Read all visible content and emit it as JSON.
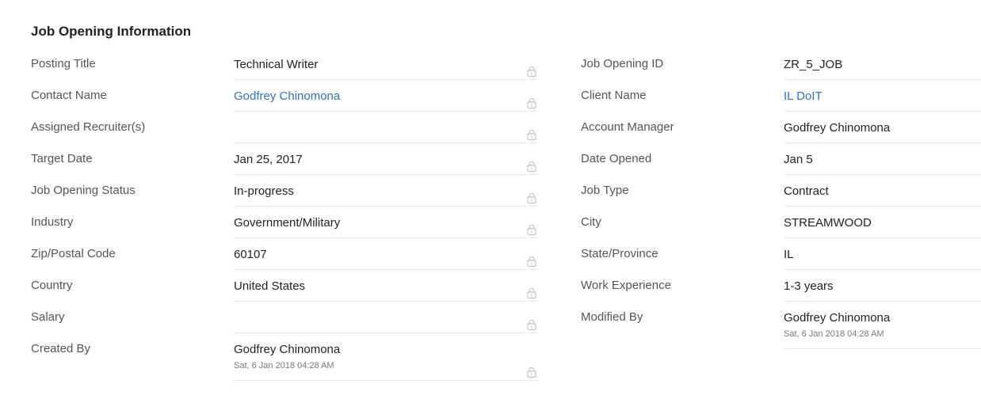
{
  "section": {
    "title": "Job Opening Information"
  },
  "left_fields": [
    {
      "label": "Posting Title",
      "value": "Technical Writer",
      "link": false,
      "sub": ""
    },
    {
      "label": "Contact Name",
      "value": "Godfrey Chinomona",
      "link": true,
      "sub": ""
    },
    {
      "label": "Assigned Recruiter(s)",
      "value": "",
      "link": false,
      "sub": ""
    },
    {
      "label": "Target Date",
      "value": "Jan 25, 2017",
      "link": false,
      "sub": ""
    },
    {
      "label": "Job Opening Status",
      "value": "In-progress",
      "link": false,
      "sub": ""
    },
    {
      "label": "Industry",
      "value": "Government/Military",
      "link": false,
      "sub": ""
    },
    {
      "label": "Zip/Postal Code",
      "value": "60107",
      "link": false,
      "sub": ""
    },
    {
      "label": "Country",
      "value": "United States",
      "link": false,
      "sub": ""
    },
    {
      "label": "Salary",
      "value": "",
      "link": false,
      "sub": ""
    },
    {
      "label": "Created By",
      "value": "Godfrey Chinomona",
      "link": false,
      "sub": "Sat, 6 Jan 2018 04:28 AM"
    }
  ],
  "right_fields": [
    {
      "label": "Job Opening ID",
      "value": "ZR_5_JOB",
      "link": false,
      "sub": ""
    },
    {
      "label": "Client Name",
      "value": "IL DoIT",
      "link": true,
      "sub": ""
    },
    {
      "label": "Account Manager",
      "value": "Godfrey Chinomona",
      "link": false,
      "sub": ""
    },
    {
      "label": "Date Opened",
      "value": "Jan 5",
      "link": false,
      "sub": ""
    },
    {
      "label": "Job Type",
      "value": "Contract",
      "link": false,
      "sub": ""
    },
    {
      "label": "City",
      "value": "STREAMWOOD",
      "link": false,
      "sub": ""
    },
    {
      "label": "State/Province",
      "value": "IL",
      "link": false,
      "sub": ""
    },
    {
      "label": "Work Experience",
      "value": "1-3 years",
      "link": false,
      "sub": ""
    },
    {
      "label": "Modified By",
      "value": "Godfrey Chinomona",
      "link": false,
      "sub": "Sat, 6 Jan 2018 04:28 AM"
    }
  ],
  "icons": {
    "lock": "lock-icon"
  },
  "colors": {
    "link": "#2a73c5",
    "label": "#555555",
    "value": "#222222",
    "divider": "#e8e8e8"
  }
}
